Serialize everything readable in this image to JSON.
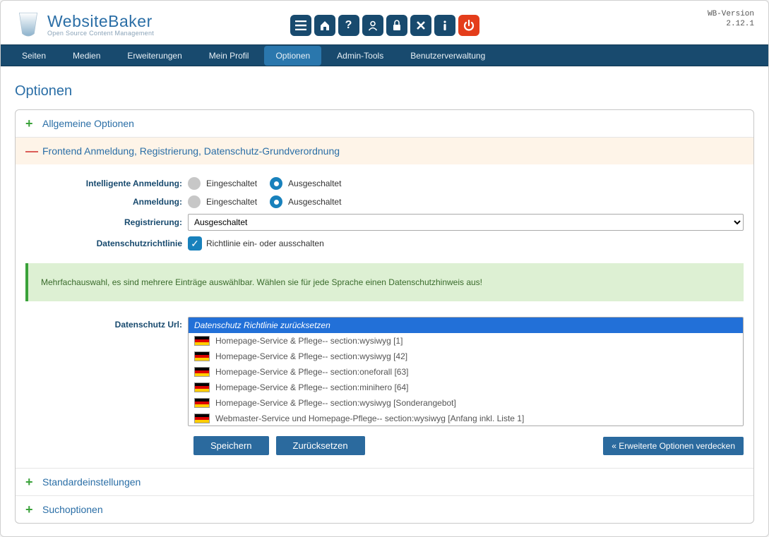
{
  "brand": {
    "title": "WebsiteBaker",
    "subtitle": "Open Source Content Management"
  },
  "version": {
    "label": "WB-Version",
    "number": "2.12.1"
  },
  "nav": {
    "items": [
      "Seiten",
      "Medien",
      "Erweiterungen",
      "Mein Profil",
      "Optionen",
      "Admin-Tools",
      "Benutzerverwaltung"
    ],
    "active": "Optionen"
  },
  "page_title": "Optionen",
  "sections": {
    "general": {
      "title": "Allgemeine Optionen"
    },
    "frontend": {
      "title": "Frontend Anmeldung, Registrierung, Datenschutz-Grundverordnung"
    },
    "defaults": {
      "title": "Standardeinstellungen"
    },
    "search": {
      "title": "Suchoptionen"
    }
  },
  "form": {
    "smart_login": {
      "label": "Intelligente Anmeldung:",
      "on": "Eingeschaltet",
      "off": "Ausgeschaltet",
      "value": "off"
    },
    "login": {
      "label": "Anmeldung:",
      "on": "Eingeschaltet",
      "off": "Ausgeschaltet",
      "value": "off"
    },
    "registration": {
      "label": "Registrierung:",
      "value": "Ausgeschaltet"
    },
    "policy": {
      "label": "Datenschutzrichtlinie",
      "desc": "Richtlinie ein- oder ausschalten"
    },
    "info": "Mehrfachauswahl, es sind mehrere Einträge auswählbar. Wählen sie für jede Sprache einen Datenschutzhinweis aus!",
    "privacy_url": {
      "label": "Datenschutz Url:",
      "options": [
        {
          "text": "Datenschutz Richtlinie zurücksetzen",
          "flag": false,
          "selected": true
        },
        {
          "text": "Homepage-Service & Pflege-- section:wysiwyg [1]",
          "flag": true
        },
        {
          "text": "Homepage-Service & Pflege-- section:wysiwyg [42]",
          "flag": true
        },
        {
          "text": "Homepage-Service & Pflege-- section:oneforall [63]",
          "flag": true
        },
        {
          "text": "Homepage-Service & Pflege-- section:minihero [64]",
          "flag": true
        },
        {
          "text": "Homepage-Service & Pflege-- section:wysiwyg [Sonderangebot]",
          "flag": true
        },
        {
          "text": "Webmaster-Service und Homepage-Pflege-- section:wysiwyg [Anfang inkl. Liste 1]",
          "flag": true
        }
      ]
    }
  },
  "buttons": {
    "save": "Speichern",
    "reset": "Zurücksetzen",
    "hide_advanced": "« Erweiterte Optionen verdecken"
  }
}
